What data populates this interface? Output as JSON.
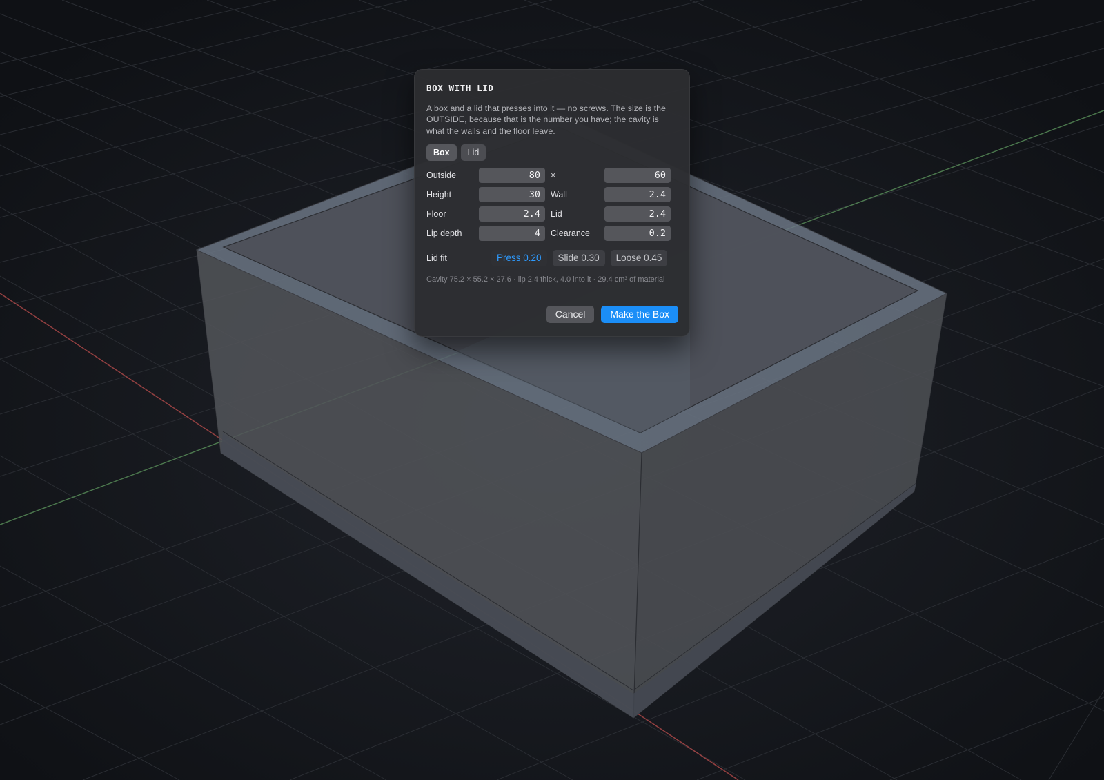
{
  "dialog": {
    "title": "BOX WITH LID",
    "description": "A box and a lid that presses into it — no screws. The size is the OUTSIDE, because that is the number you have; the cavity is what the walls and the floor leave.",
    "tabs": [
      {
        "label": "Box",
        "active": true
      },
      {
        "label": "Lid",
        "active": false
      }
    ],
    "fields": {
      "outside_label": "Outside",
      "outside_width": "80",
      "times_sign": "×",
      "outside_depth": "60",
      "height_label": "Height",
      "height": "30",
      "wall_label": "Wall",
      "wall": "2.4",
      "floor_label": "Floor",
      "floor": "2.4",
      "lid_label": "Lid",
      "lid": "2.4",
      "lip_depth_label": "Lip depth",
      "lip_depth": "4",
      "clearance_label": "Clearance",
      "clearance": "0.2"
    },
    "lid_fit": {
      "label": "Lid fit",
      "options": [
        {
          "label": "Press 0.20",
          "selected": true
        },
        {
          "label": "Slide 0.30",
          "selected": false
        },
        {
          "label": "Loose 0.45",
          "selected": false
        }
      ]
    },
    "summary": "Cavity 75.2 × 55.2 × 27.6 · lip 2.4 thick, 4.0 into it · 29.4 cm³ of material",
    "cancel_label": "Cancel",
    "confirm_label": "Make the Box"
  },
  "colors": {
    "accent": "#1b8ef7",
    "selected_text": "#2e9bff",
    "background": "#111318",
    "axis_x": "#b34a4a",
    "axis_y": "#5f9a5f"
  }
}
